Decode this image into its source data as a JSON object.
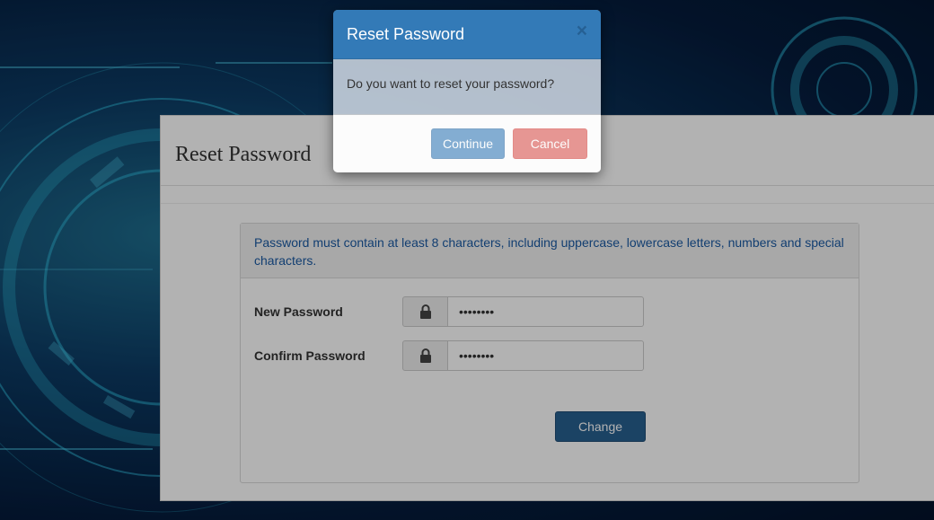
{
  "background": {
    "primary_color": "#0c3a63",
    "accent_color": "#2aa6c9"
  },
  "page": {
    "title": "Reset Password",
    "info_text": "Password must contain at least 8 characters, including uppercase, lowercase letters, numbers and special characters.",
    "fields": [
      {
        "label": "New Password",
        "value": "••••••••",
        "icon": "lock-icon"
      },
      {
        "label": "Confirm Password",
        "value": "••••••••",
        "icon": "lock-icon"
      }
    ],
    "submit_label": "Change"
  },
  "modal": {
    "title": "Reset Password",
    "close_glyph": "×",
    "message": "Do you want to reset your password?",
    "confirm_label": "Continue",
    "cancel_label": "Cancel",
    "header_color": "#337ab7",
    "cancel_color": "#d9534f"
  }
}
